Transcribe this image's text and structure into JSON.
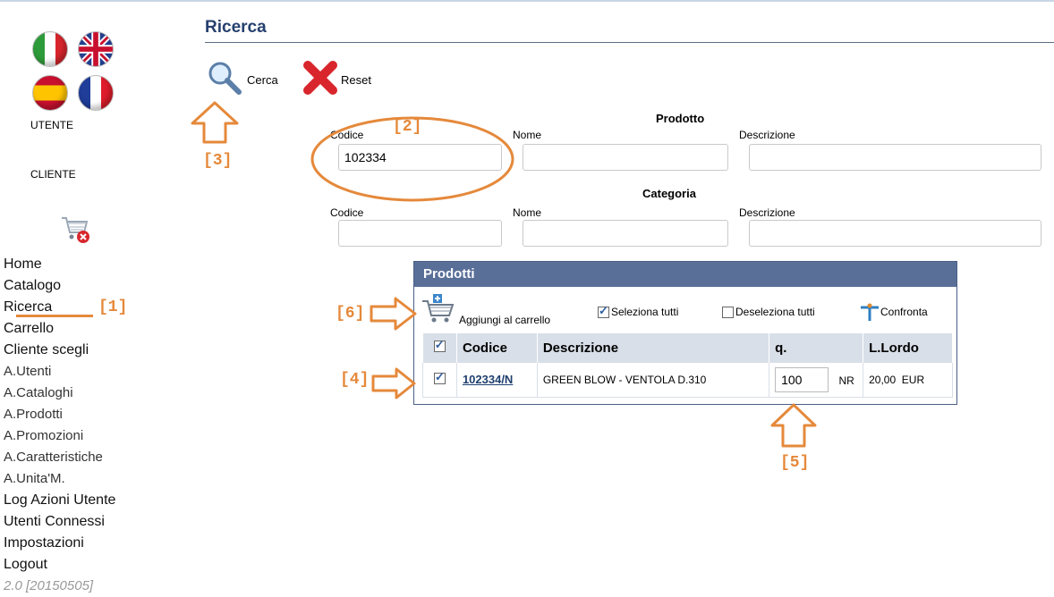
{
  "sidebar": {
    "flags": [
      "Italiano",
      "English",
      "Español",
      "Français"
    ],
    "utente_label": "UTENTE",
    "cliente_label": "CLIENTE",
    "cart_icon": "cart-remove-icon",
    "nav": [
      "Home",
      "Catalogo",
      "Ricerca",
      "Carrello",
      "Cliente scegli"
    ],
    "admin": [
      "A.Utenti",
      "A.Cataloghi",
      "A.Prodotti",
      "A.Promozioni",
      "A.Caratteristiche",
      "A.Unita'M."
    ],
    "bottom": [
      "Log Azioni Utente",
      "Utenti Connessi",
      "Impostazioni",
      "Logout"
    ],
    "version": "2.0 [20150505]"
  },
  "page": {
    "title": "Ricerca",
    "cerca_label": "Cerca",
    "reset_label": "Reset"
  },
  "prodotto": {
    "title": "Prodotto",
    "codice_label": "Codice",
    "codice_value": "102334",
    "nome_label": "Nome",
    "nome_value": "",
    "descrizione_label": "Descrizione",
    "descrizione_value": ""
  },
  "categoria": {
    "title": "Categoria",
    "codice_label": "Codice",
    "nome_label": "Nome",
    "descrizione_label": "Descrizione"
  },
  "products": {
    "title": "Prodotti",
    "add_to_cart": "Aggiungi al carrello",
    "select_all": "Seleziona tutti",
    "deselect_all": "Deseleziona tutti",
    "compare": "Confronta",
    "columns": [
      "Codice",
      "Descrizione",
      "q.",
      "L.Lordo"
    ],
    "rows": [
      {
        "checked": true,
        "codice": "102334/N",
        "descrizione": "GREEN BLOW - VENTOLA D.310",
        "qty": "100",
        "unit": "NR",
        "lordo": "20,00  EUR"
      }
    ]
  },
  "annotations": [
    "[1]",
    "[2]",
    "[3]",
    "[4]",
    "[5]",
    "[6]"
  ],
  "colors": {
    "accent": "#26406e",
    "panel_header": "#5a6f98",
    "annotation": "#e5893b"
  }
}
